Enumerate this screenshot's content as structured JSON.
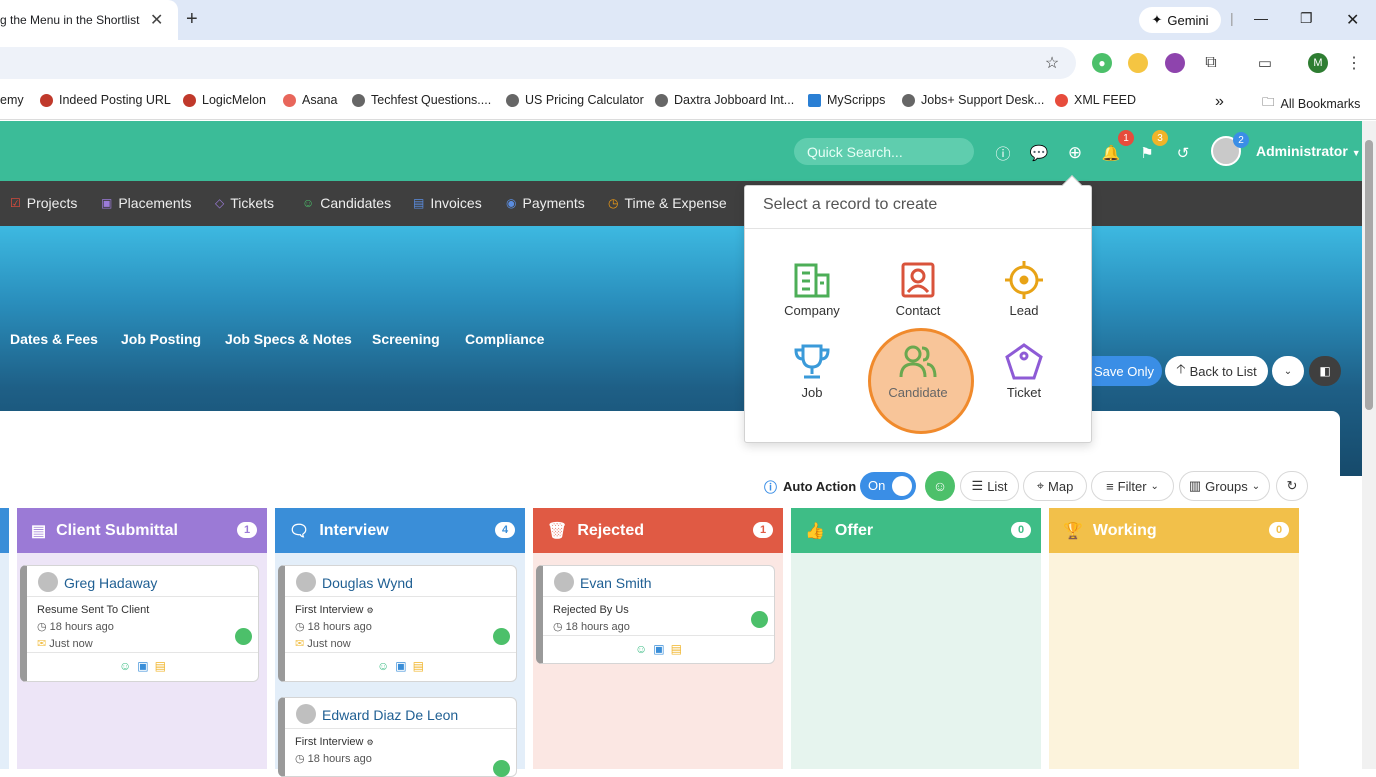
{
  "browser": {
    "tab_title": "g the Menu in the Shortlist",
    "tab_close": "✕",
    "new_tab": "+",
    "gemini_label": "Gemini",
    "profile_initial": "M",
    "bookmarks": [
      {
        "label": "emy",
        "color": ""
      },
      {
        "label": "Indeed Posting URL",
        "color": "#c0392b"
      },
      {
        "label": "LogicMelon",
        "color": "#c0392b"
      },
      {
        "label": "Asana",
        "color": "#e8665b"
      },
      {
        "label": "Techfest Questions....",
        "color": "#555555"
      },
      {
        "label": "US Pricing Calculator",
        "color": "#555555"
      },
      {
        "label": "Daxtra Jobboard Int...",
        "color": "#555555"
      },
      {
        "label": "MyScripps",
        "color": "#2a7fd4"
      },
      {
        "label": "Jobs+ Support Desk...",
        "color": "#555555"
      },
      {
        "label": "XML FEED",
        "color": "#e74c3c"
      }
    ],
    "more_bookmarks": "»",
    "all_bookmarks": "All Bookmarks"
  },
  "header": {
    "search_placeholder": "Quick Search...",
    "badges": {
      "notifications": "1",
      "flags": "3",
      "avatar": "2"
    },
    "user_name": "Administrator"
  },
  "nav": {
    "items": [
      {
        "label": "Projects",
        "icon": "☑",
        "color": "#e74c3c"
      },
      {
        "label": "Placements",
        "icon": "▣",
        "color": "#9b7bd8"
      },
      {
        "label": "Tickets",
        "icon": "◇",
        "color": "#9b7bd8"
      },
      {
        "label": "Candidates",
        "icon": "☺",
        "color": "#4cc06a"
      },
      {
        "label": "Invoices",
        "icon": "▤",
        "color": "#5b8de0"
      },
      {
        "label": "Payments",
        "icon": "◉",
        "color": "#5b8de0"
      },
      {
        "label": "Time & Expense",
        "icon": "◷",
        "color": "#f39c12"
      }
    ]
  },
  "hero": {
    "tabs": [
      "Dates & Fees",
      "Job Posting",
      "Job Specs & Notes",
      "Screening",
      "Compliance"
    ],
    "save_only": "Save Only",
    "back_to_list": "Back to List"
  },
  "toolbar": {
    "auto_action": "Auto Action",
    "toggle_label": "On",
    "list": "List",
    "map": "Map",
    "filter": "Filter",
    "groups": "Groups"
  },
  "columns": [
    {
      "title": "Client Submittal",
      "count": "1",
      "color": "#9b7ad6",
      "body": "#ede5f7"
    },
    {
      "title": "Interview",
      "count": "4",
      "color": "#3a8ed8",
      "body": "#e3eef9"
    },
    {
      "title": "Rejected",
      "count": "1",
      "color": "#e05a44",
      "body": "#fbe7e3"
    },
    {
      "title": "Offer",
      "count": "0",
      "color": "#3ebd86",
      "body": "#e6f4ee"
    },
    {
      "title": "Working",
      "count": "0",
      "color": "#f2c04a",
      "body": "#fcf3dc"
    }
  ],
  "cards": [
    {
      "name": "Greg Hadaway",
      "status": "Resume Sent To Client",
      "time": "18 hours ago",
      "just": "Just now"
    },
    {
      "name": "Douglas Wynd",
      "status": "First Interview",
      "time": "18 hours ago",
      "just": "Just now"
    },
    {
      "name": "Edward Diaz De Leon",
      "status": "First Interview",
      "time": "18 hours ago",
      "just": ""
    },
    {
      "name": "Evan Smith",
      "status": "Rejected By Us",
      "time": "18 hours ago",
      "just": ""
    }
  ],
  "create_menu": {
    "title": "Select a record to create",
    "items": [
      {
        "label": "Company",
        "color": "#4cae57"
      },
      {
        "label": "Contact",
        "color": "#d9533b"
      },
      {
        "label": "Lead",
        "color": "#e8a316"
      },
      {
        "label": "Job",
        "color": "#3a9ad9"
      },
      {
        "label": "Candidate",
        "color": "#6aa84f"
      },
      {
        "label": "Ticket",
        "color": "#8e5bd6"
      }
    ]
  }
}
